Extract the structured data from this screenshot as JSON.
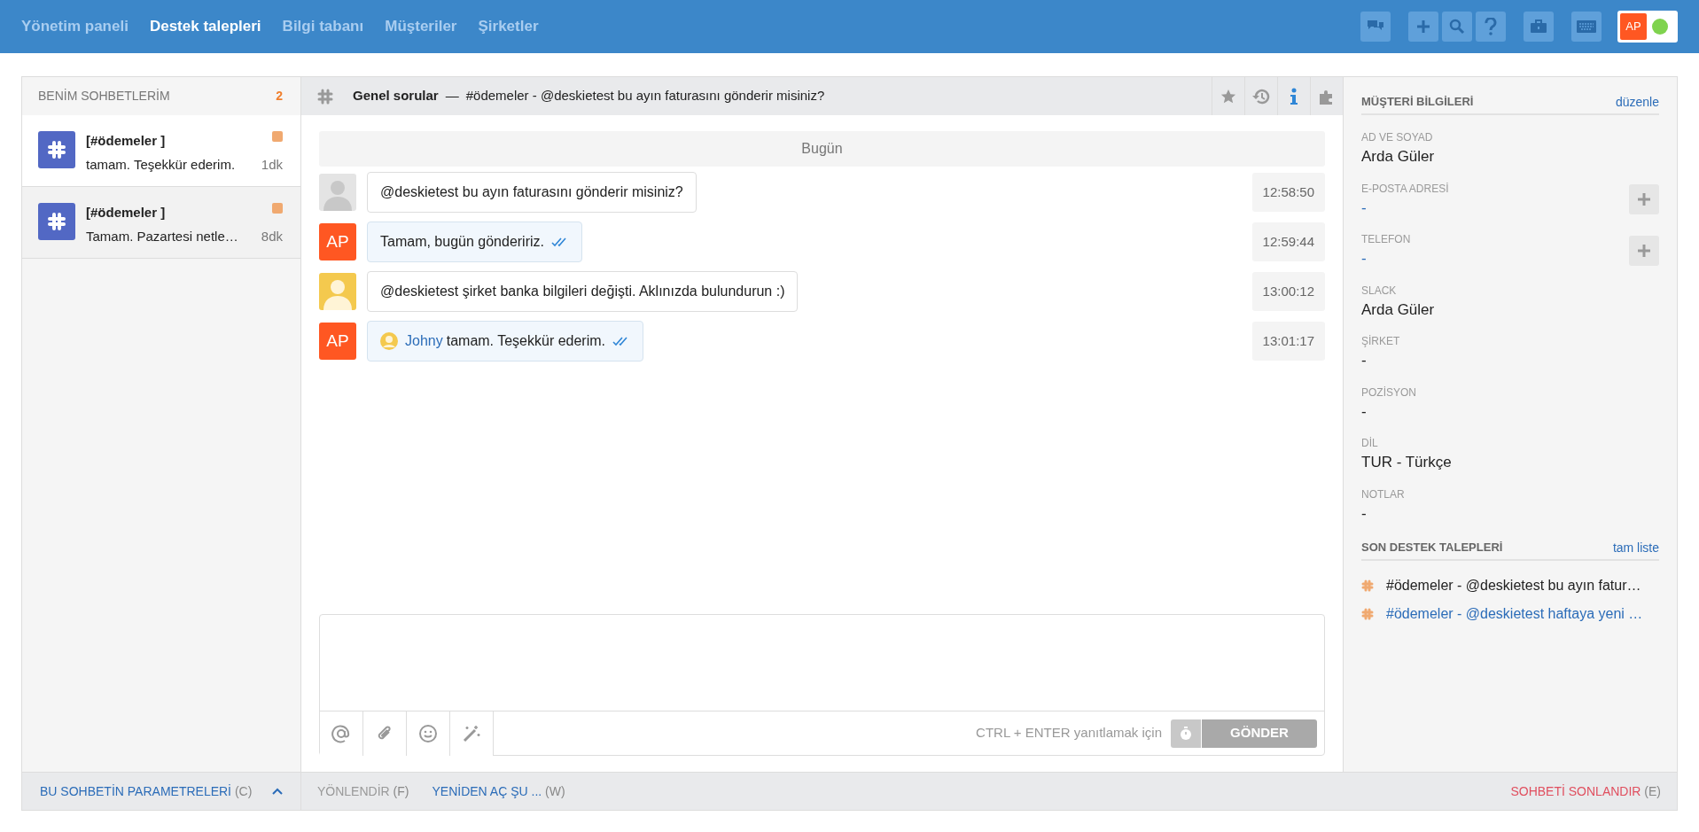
{
  "nav": {
    "links": [
      {
        "label": "Yönetim paneli",
        "selected": false
      },
      {
        "label": "Destek talepleri",
        "selected": true
      },
      {
        "label": "Bilgi tabanı",
        "selected": false
      },
      {
        "label": "Müşteriler",
        "selected": false
      },
      {
        "label": "Şirketler",
        "selected": false
      }
    ],
    "user": {
      "initials": "AP",
      "online": true
    }
  },
  "sidebar": {
    "title": "BENİM SOHBETLERİM",
    "count": "2",
    "chats": [
      {
        "title": "[#ödemeler ]",
        "preview": "tamam. Teşekkür ederim.",
        "time": "1dk",
        "selected": true,
        "color": "#f0a970"
      },
      {
        "title": "[#ödemeler ]",
        "preview": "Tamam. Pazartesi netle…",
        "time": "8dk",
        "selected": false,
        "color": "#f0a970"
      }
    ],
    "footer": {
      "label": "BU SOHBETİN PARAMETRELERİ",
      "shortcut": "(C)"
    }
  },
  "conversation": {
    "channel": "Genel sorular",
    "separator": "—",
    "subject": "#ödemeler - @deskietest bu ayın faturasını gönderir misiniz?",
    "side_tabs": [
      {
        "selected": false
      },
      {
        "selected": false
      },
      {
        "selected": true
      },
      {
        "selected": false
      }
    ],
    "date_divider": "Bugün",
    "messages": [
      {
        "kind": "incoming",
        "color": "#e4e4e4",
        "text": "@deskietest bu ayın faturasını gönderir misiniz?",
        "time": "12:58:50"
      },
      {
        "kind": "outgoing",
        "initials": "AP",
        "text": "Tamam, bugün göndeririz.",
        "read": true,
        "time": "12:59:44"
      },
      {
        "kind": "incoming",
        "color": "#f4c94e",
        "text": "@deskietest şirket banka bilgileri değişti. Aklınızda bulundurun :)",
        "time": "13:00:12"
      },
      {
        "kind": "outgoing",
        "initials": "AP",
        "mention": "Johny",
        "text": "tamam. Teşekkür ederim.",
        "read": true,
        "time": "13:01:17"
      }
    ],
    "composer": {
      "hint": "CTRL + ENTER yanıtlamak için",
      "send": "GÖNDER",
      "disabled": true
    },
    "actions": [
      {
        "label": "YÖNLENDİR",
        "shortcut": "(F)",
        "disabled": true
      },
      {
        "label": "YENİDEN AÇ ŞU ...",
        "shortcut": "(W)",
        "disabled": false
      }
    ],
    "close_action": {
      "label": "SOHBETİ SONLANDIR",
      "shortcut": "(E)"
    }
  },
  "customer": {
    "title": "MÜŞTERİ BİLGİLERİ",
    "edit": "düzenle",
    "fields": [
      {
        "label": "AD VE SOYAD",
        "value": "Arda Güler",
        "kind": "text"
      },
      {
        "label": "E-POSTA ADRESİ",
        "value": "-",
        "kind": "addable"
      },
      {
        "label": "TELEFON",
        "value": "-",
        "kind": "addable"
      },
      {
        "label": "SLACK",
        "value": "Arda Güler",
        "kind": "text"
      },
      {
        "label": "ŞİRKET",
        "value": "-",
        "kind": "text"
      },
      {
        "label": "POZİSYON",
        "value": "-",
        "kind": "text"
      },
      {
        "label": "DİL",
        "value": "TUR - Türkçe",
        "kind": "text"
      },
      {
        "label": "NOTLAR",
        "value": "-",
        "kind": "text"
      }
    ],
    "recent": {
      "title": "SON DESTEK TALEPLERİ",
      "link": "tam liste",
      "items": [
        {
          "text": "#ödemeler - @deskietest bu ayın fatur…",
          "selected": true
        },
        {
          "text": "#ödemeler - @deskietest haftaya yeni …",
          "selected": false
        }
      ]
    }
  }
}
